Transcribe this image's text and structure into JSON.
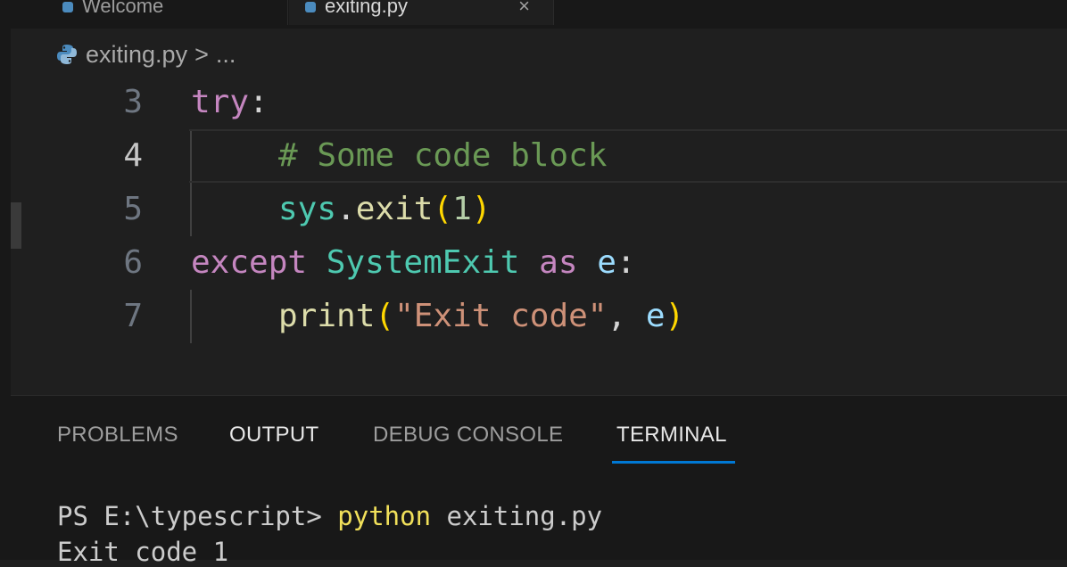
{
  "tabs": [
    {
      "label": "Welcome",
      "active": false
    },
    {
      "label": "exiting.py",
      "active": true,
      "close": "×"
    }
  ],
  "breadcrumb": {
    "file": "exiting.py",
    "separator": ">",
    "more": "..."
  },
  "editor": {
    "current_line": 4,
    "lines": [
      {
        "number": "3",
        "tokens": {
          "t1": "try",
          "t2": ":"
        }
      },
      {
        "number": "4",
        "tokens": {
          "t1": "# Some code block"
        }
      },
      {
        "number": "5",
        "tokens": {
          "t1": "sys",
          "t2": ".",
          "t3": "exit",
          "t4": "(",
          "t5": "1",
          "t6": ")"
        }
      },
      {
        "number": "6",
        "tokens": {
          "t1": "except",
          "t2": " ",
          "t3": "SystemExit",
          "t4": " ",
          "t5": "as",
          "t6": " ",
          "t7": "e",
          "t8": ":"
        }
      },
      {
        "number": "7",
        "tokens": {
          "t1": "print",
          "t2": "(",
          "t3": "\"Exit code\"",
          "t4": ", ",
          "t5": "e",
          "t6": ")"
        }
      }
    ]
  },
  "panel": {
    "tabs": {
      "problems": "PROBLEMS",
      "output": "OUTPUT",
      "debug": "DEBUG CONSOLE",
      "terminal": "TERMINAL"
    },
    "active_tab": "TERMINAL",
    "terminal": {
      "prompt": "PS E:\\typescript> ",
      "command": "python",
      "args": " exiting.py",
      "output": "Exit code 1"
    }
  },
  "colors": {
    "background": "#1f1f1f",
    "panel_background": "#181818",
    "keyword": "#c586c0",
    "class": "#4ec9b0",
    "function": "#dcdcaa",
    "variable": "#9cdcfe",
    "number": "#b5cea8",
    "string": "#ce9178",
    "comment": "#6a9955",
    "bracket": "#ffd700",
    "accent": "#0078d4"
  },
  "icons": {
    "file_icon": "python-icon"
  }
}
